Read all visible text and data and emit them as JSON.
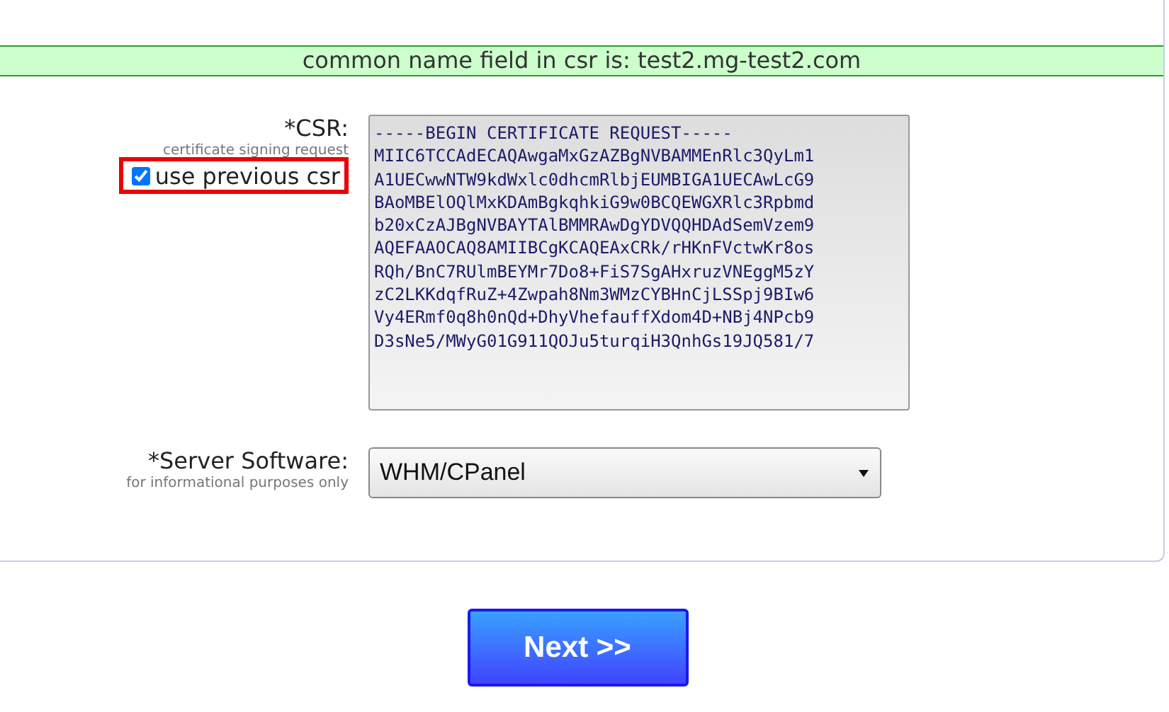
{
  "banner": {
    "text": "common name field in csr is: test2.mg-test2.com"
  },
  "csr": {
    "label": "*CSR:",
    "hint": "certificate signing request",
    "use_previous": {
      "label": "use previous csr",
      "checked": true
    },
    "lines": [
      "-----BEGIN CERTIFICATE REQUEST-----",
      "MIIC6TCCAdECAQAwgaMxGzAZBgNVBAMMEnRlc3QyLm1",
      "A1UECwwNTW9kdWxlc0dhcmRlbjEUMBIGA1UECAwLcG9",
      "BAoMBElOQlMxKDAmBgkqhkiG9w0BCQEWGXRlc3Rpbmd",
      "b20xCzAJBgNVBAYTAlBMMRAwDgYDVQQHDAdSemVzem9",
      "AQEFAAOCAQ8AMIIBCgKCAQEAxCRk/rHKnFVctwKr8os",
      "RQh/BnC7RUlmBEYMr7Do8+FiS7SgAHxruzVNEggM5zY",
      "zC2LKKdqfRuZ+4Zwpah8Nm3WMzCYBHnCjLSSpj9BIw6",
      "Vy4ERmf0q8h0nQd+DhyVhefauffXdom4D+NBj4NPcb9",
      "D3sNe5/MWyG01G911QOJu5turqiH3QnhGs19JQ581/7"
    ]
  },
  "server": {
    "label": "*Server Software:",
    "hint": "for informational purposes only",
    "value": "WHM/CPanel"
  },
  "next_button": {
    "label": "Next >>"
  }
}
